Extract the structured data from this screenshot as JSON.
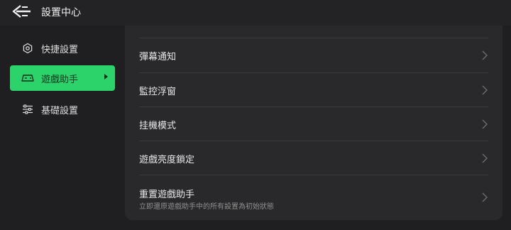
{
  "header": {
    "back_icon": "back-arrow-icon",
    "title": "設置中心"
  },
  "sidebar": {
    "items": [
      {
        "label": "快捷設置",
        "icon": "hexagon-icon",
        "active": false
      },
      {
        "label": "遊戲助手",
        "icon": "gamepad-icon",
        "active": true
      },
      {
        "label": "基礎設置",
        "icon": "sliders-icon",
        "active": false
      }
    ]
  },
  "main": {
    "rows": [
      {
        "title": "彈幕通知",
        "subtitle": ""
      },
      {
        "title": "監控浮窗",
        "subtitle": ""
      },
      {
        "title": "挂機模式",
        "subtitle": ""
      },
      {
        "title": "遊戲亮度鎖定",
        "subtitle": ""
      },
      {
        "title": "重置遊戲助手",
        "subtitle": "立即還原遊戲助手中的所有設置為初始狀態"
      }
    ]
  },
  "colors": {
    "accent": "#2bd36a",
    "background": "#1f1f21",
    "panel": "#29292b"
  }
}
